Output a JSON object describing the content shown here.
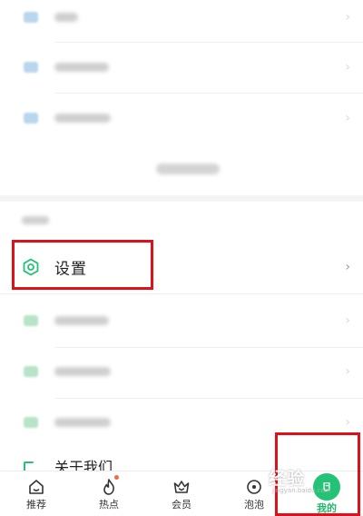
{
  "settings": {
    "label": "设置",
    "chevron": "›"
  },
  "blurred_chevron": "›",
  "about": {
    "label": "关于我们"
  },
  "tabbar": {
    "tabs": [
      {
        "label": "推荐",
        "icon": "home-icon"
      },
      {
        "label": "热点",
        "icon": "flame-icon",
        "badge": true
      },
      {
        "label": "会员",
        "icon": "crown-icon"
      },
      {
        "label": "泡泡",
        "icon": "bubble-icon"
      },
      {
        "label": "我的",
        "icon": "profile-icon",
        "active": true
      }
    ]
  },
  "watermark": {
    "text": "经验",
    "url": "jingyan.baidu.com"
  },
  "colors": {
    "accent": "#22c374",
    "highlight_box": "#e0101a",
    "badge": "#f26b3a"
  }
}
